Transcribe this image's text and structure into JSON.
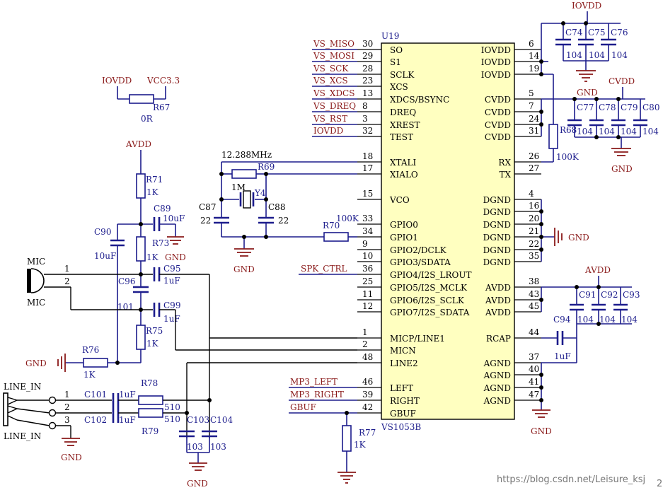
{
  "chip": {
    "ref": "U19",
    "part": "VS1053B"
  },
  "left_pins": [
    {
      "num": "30",
      "name": "SO",
      "net": "VS_MISO"
    },
    {
      "num": "29",
      "name": "S1",
      "net": "VS_MOSI"
    },
    {
      "num": "28",
      "name": "SCLK",
      "net": "VS_SCK"
    },
    {
      "num": "23",
      "name": "XCS",
      "net": "VS_XCS"
    },
    {
      "num": "13",
      "name": "XDCS/BSYNC",
      "net": "VS_XDCS"
    },
    {
      "num": "8",
      "name": "DREQ",
      "net": "VS_DREQ"
    },
    {
      "num": "3",
      "name": "XREST",
      "net": "VS_RST"
    },
    {
      "num": "32",
      "name": "TEST",
      "net": "IOVDD"
    },
    {
      "num": "18",
      "name": "XTALI",
      "net": ""
    },
    {
      "num": "17",
      "name": "XIALO",
      "net": ""
    },
    {
      "num": "15",
      "name": "VCO",
      "net": ""
    },
    {
      "num": "33",
      "name": "GPIO0",
      "net": ""
    },
    {
      "num": "34",
      "name": "GPIO1",
      "net": ""
    },
    {
      "num": "9",
      "name": "GPIO2/DCLK",
      "net": ""
    },
    {
      "num": "10",
      "name": "GPIO3/SDATA",
      "net": ""
    },
    {
      "num": "36",
      "name": "GPIO4/I2S_LROUT",
      "net": "SPK_CTRL"
    },
    {
      "num": "25",
      "name": "GPIO5/I2S_MCLK",
      "net": ""
    },
    {
      "num": "11",
      "name": "GPIO6/I2S_SCLK",
      "net": ""
    },
    {
      "num": "12",
      "name": "GPIO7/I2S_SDATA",
      "net": ""
    },
    {
      "num": "1",
      "name": "MICP/LINE1",
      "net": ""
    },
    {
      "num": "2",
      "name": "MICN",
      "net": ""
    },
    {
      "num": "48",
      "name": "LINE2",
      "net": ""
    },
    {
      "num": "46",
      "name": "LEFT",
      "net": "MP3_LEFT"
    },
    {
      "num": "39",
      "name": "RIGHT",
      "net": "MP3_RIGHT"
    },
    {
      "num": "42",
      "name": "GBUF",
      "net": "GBUF"
    }
  ],
  "right_pins": [
    {
      "num": "6",
      "name": "IOVDD"
    },
    {
      "num": "14",
      "name": "IOVDD"
    },
    {
      "num": "19",
      "name": "IOVDD"
    },
    {
      "num": "5",
      "name": "CVDD"
    },
    {
      "num": "7",
      "name": "CVDD"
    },
    {
      "num": "24",
      "name": "CVDD"
    },
    {
      "num": "31",
      "name": "CVDD"
    },
    {
      "num": "26",
      "name": "RX"
    },
    {
      "num": "27",
      "name": "TX"
    },
    {
      "num": "4",
      "name": "DGND"
    },
    {
      "num": "16",
      "name": "DGND"
    },
    {
      "num": "20",
      "name": "DGND"
    },
    {
      "num": "21",
      "name": "DGND"
    },
    {
      "num": "22",
      "name": "DGND"
    },
    {
      "num": "35",
      "name": "DGND"
    },
    {
      "num": "38",
      "name": "AVDD"
    },
    {
      "num": "43",
      "name": "AVDD"
    },
    {
      "num": "45",
      "name": "AVDD"
    },
    {
      "num": "44",
      "name": "RCAP"
    },
    {
      "num": "37",
      "name": "AGND"
    },
    {
      "num": "40",
      "name": "AGND"
    },
    {
      "num": "41",
      "name": "AGND"
    },
    {
      "num": "47",
      "name": "AGND"
    }
  ],
  "labels": {
    "iovdd": "IOVDD",
    "vcc33": "VCC3.3",
    "avdd": "AVDD",
    "cvdd": "CVDD",
    "gnd": "GND",
    "r67": "R67",
    "r67v": "0R",
    "r71": "R71",
    "r71v": "1K",
    "r73": "R73",
    "r73v": "1K",
    "r75": "R75",
    "r75v": "1K",
    "r76": "R76",
    "r76v": "1K",
    "r78": "R78",
    "r78v": "510",
    "r79": "R79",
    "r79v": "510",
    "r68": "R68",
    "r68v": "100K",
    "r69": "R69",
    "r69v": "1M",
    "r70": "R70",
    "r70v": "100K",
    "r77": "R77",
    "r77v": "1K",
    "c89": "C89",
    "c89v": "10uF",
    "c90": "C90",
    "c90v": "10uF",
    "c95": "C95",
    "c95v": "1uF",
    "c96": "C96",
    "c96v": "101",
    "c99": "C99",
    "c99v": "1uF",
    "c101": "C101",
    "c101v": "1uF",
    "c102": "C102",
    "c102v": "1uF",
    "c103": "C103",
    "c103v": "103",
    "c104": "C104",
    "c104v": "103",
    "c87": "C87",
    "c87v": "22",
    "c88": "C88",
    "c88v": "22",
    "c94": "C94",
    "c94v": "1uF",
    "c74": "C74",
    "c75": "C75",
    "c76": "C76",
    "c77": "C77",
    "c78": "C78",
    "c79": "C79",
    "c80": "C80",
    "c91": "C91",
    "c92": "C92",
    "c93": "C93",
    "v104": "104",
    "y4": "Y4",
    "xtal": "12.288MHz",
    "mic": "MIC",
    "mic1": "1",
    "mic2": "2",
    "linein": "LINE_IN",
    "jp1": "1",
    "jp2": "2",
    "jp3": "3"
  },
  "watermark": "https://blog.csdn.net/Leisure_ksj",
  "corner": "2"
}
